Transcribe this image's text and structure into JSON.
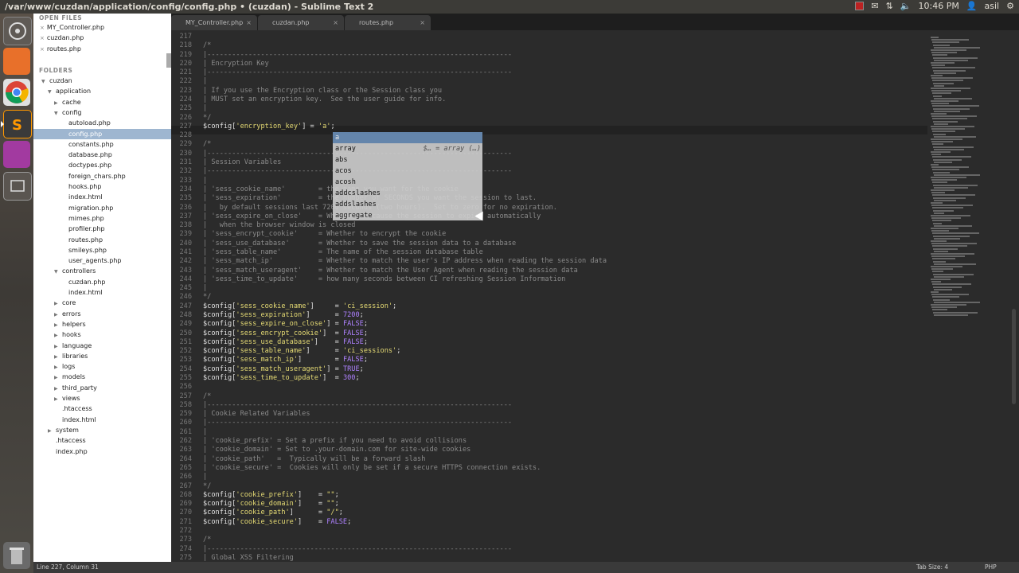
{
  "window": {
    "title": "/var/www/cuzdan/application/config/config.php • (cuzdan) - Sublime Text 2",
    "clock": "10:46 PM",
    "user": "asil"
  },
  "launcher": {
    "items": [
      {
        "name": "dash-icon",
        "color": "#5a5550"
      },
      {
        "name": "files-icon",
        "color": "#e8702a"
      },
      {
        "name": "chrome-icon",
        "color": "#2f8f3f"
      },
      {
        "name": "sublime-icon",
        "color": "#4a4a4a"
      },
      {
        "name": "video-editor-icon",
        "color": "#a23aa0"
      },
      {
        "name": "workspace-icon",
        "color": "#5a5a5a"
      },
      {
        "name": "trash-icon",
        "color": "#777"
      }
    ]
  },
  "sidebar": {
    "open_files_header": "OPEN FILES",
    "folders_header": "FOLDERS",
    "open_files": [
      "MY_Controller.php",
      "cuzdan.php",
      "routes.php"
    ],
    "tree": [
      {
        "label": "cuzdan",
        "indent": 0,
        "type": "open"
      },
      {
        "label": "application",
        "indent": 1,
        "type": "open"
      },
      {
        "label": "cache",
        "indent": 2,
        "type": "closed"
      },
      {
        "label": "config",
        "indent": 2,
        "type": "open"
      },
      {
        "label": "autoload.php",
        "indent": 3,
        "type": "file"
      },
      {
        "label": "config.php",
        "indent": 3,
        "type": "file",
        "selected": true
      },
      {
        "label": "constants.php",
        "indent": 3,
        "type": "file"
      },
      {
        "label": "database.php",
        "indent": 3,
        "type": "file"
      },
      {
        "label": "doctypes.php",
        "indent": 3,
        "type": "file"
      },
      {
        "label": "foreign_chars.php",
        "indent": 3,
        "type": "file"
      },
      {
        "label": "hooks.php",
        "indent": 3,
        "type": "file"
      },
      {
        "label": "index.html",
        "indent": 3,
        "type": "file"
      },
      {
        "label": "migration.php",
        "indent": 3,
        "type": "file"
      },
      {
        "label": "mimes.php",
        "indent": 3,
        "type": "file"
      },
      {
        "label": "profiler.php",
        "indent": 3,
        "type": "file"
      },
      {
        "label": "routes.php",
        "indent": 3,
        "type": "file"
      },
      {
        "label": "smileys.php",
        "indent": 3,
        "type": "file"
      },
      {
        "label": "user_agents.php",
        "indent": 3,
        "type": "file"
      },
      {
        "label": "controllers",
        "indent": 2,
        "type": "open"
      },
      {
        "label": "cuzdan.php",
        "indent": 3,
        "type": "file"
      },
      {
        "label": "index.html",
        "indent": 3,
        "type": "file"
      },
      {
        "label": "core",
        "indent": 2,
        "type": "closed"
      },
      {
        "label": "errors",
        "indent": 2,
        "type": "closed"
      },
      {
        "label": "helpers",
        "indent": 2,
        "type": "closed"
      },
      {
        "label": "hooks",
        "indent": 2,
        "type": "closed"
      },
      {
        "label": "language",
        "indent": 2,
        "type": "closed"
      },
      {
        "label": "libraries",
        "indent": 2,
        "type": "closed"
      },
      {
        "label": "logs",
        "indent": 2,
        "type": "closed"
      },
      {
        "label": "models",
        "indent": 2,
        "type": "closed"
      },
      {
        "label": "third_party",
        "indent": 2,
        "type": "closed"
      },
      {
        "label": "views",
        "indent": 2,
        "type": "closed"
      },
      {
        "label": ".htaccess",
        "indent": 2,
        "type": "file"
      },
      {
        "label": "index.html",
        "indent": 2,
        "type": "file"
      },
      {
        "label": "system",
        "indent": 1,
        "type": "closed"
      },
      {
        "label": ".htaccess",
        "indent": 1,
        "type": "file"
      },
      {
        "label": "index.php",
        "indent": 1,
        "type": "file"
      }
    ]
  },
  "tabs": [
    {
      "label": "MY_Controller.php",
      "close": "×"
    },
    {
      "label": "cuzdan.php",
      "close": "×"
    },
    {
      "label": "routes.php",
      "close": "×"
    }
  ],
  "editor": {
    "lines": [
      {
        "n": "217",
        "t": ""
      },
      {
        "n": "218",
        "t": "/*",
        "c": "cm"
      },
      {
        "n": "219",
        "t": "|--------------------------------------------------------------------------",
        "c": "cm"
      },
      {
        "n": "220",
        "t": "| Encryption Key",
        "c": "cm"
      },
      {
        "n": "221",
        "t": "|--------------------------------------------------------------------------",
        "c": "cm"
      },
      {
        "n": "222",
        "t": "|",
        "c": "cm"
      },
      {
        "n": "223",
        "t": "| If you use the Encryption class or the Session class you",
        "c": "cm"
      },
      {
        "n": "224",
        "t": "| MUST set an encryption key.  See the user guide for info.",
        "c": "cm"
      },
      {
        "n": "225",
        "t": "|",
        "c": "cm"
      },
      {
        "n": "226",
        "t": "*/",
        "c": "cm"
      },
      {
        "n": "227",
        "t": "$config['encryption_key'] = 'a';",
        "c": "var"
      },
      {
        "n": "228",
        "t": ""
      },
      {
        "n": "229",
        "t": "/*",
        "c": "cm"
      },
      {
        "n": "230",
        "t": "|--------------------------------------------------------------------------",
        "c": "cm"
      },
      {
        "n": "231",
        "t": "| Session Variables",
        "c": "cm"
      },
      {
        "n": "232",
        "t": "|--------------------------------------------------------------------------",
        "c": "cm"
      },
      {
        "n": "233",
        "t": "|",
        "c": "cm"
      },
      {
        "n": "234",
        "t": "| 'sess_cookie_name'        = the name you want for the cookie",
        "c": "cm"
      },
      {
        "n": "235",
        "t": "| 'sess_expiration'         = the number of SECONDS you want the session to last.",
        "c": "cm"
      },
      {
        "n": "236",
        "t": "|   by default sessions last 7200 seconds (two hours).  Set to zero for no expiration.",
        "c": "cm"
      },
      {
        "n": "237",
        "t": "| 'sess_expire_on_close'    = Whether to cause the session to expire automatically",
        "c": "cm"
      },
      {
        "n": "238",
        "t": "|   when the browser window is closed",
        "c": "cm"
      },
      {
        "n": "239",
        "t": "| 'sess_encrypt_cookie'     = Whether to encrypt the cookie",
        "c": "cm"
      },
      {
        "n": "240",
        "t": "| 'sess_use_database'       = Whether to save the session data to a database",
        "c": "cm"
      },
      {
        "n": "241",
        "t": "| 'sess_table_name'         = The name of the session database table",
        "c": "cm"
      },
      {
        "n": "242",
        "t": "| 'sess_match_ip'           = Whether to match the user's IP address when reading the session data",
        "c": "cm"
      },
      {
        "n": "243",
        "t": "| 'sess_match_useragent'    = Whether to match the User Agent when reading the session data",
        "c": "cm"
      },
      {
        "n": "244",
        "t": "| 'sess_time_to_update'     = how many seconds between CI refreshing Session Information",
        "c": "cm"
      },
      {
        "n": "245",
        "t": "|",
        "c": "cm"
      },
      {
        "n": "246",
        "t": "*/",
        "c": "cm"
      },
      {
        "n": "247",
        "t": "$config['sess_cookie_name']     = 'ci_session';",
        "c": "var"
      },
      {
        "n": "248",
        "t": "$config['sess_expiration']      = 7200;",
        "c": "var"
      },
      {
        "n": "249",
        "t": "$config['sess_expire_on_close'] = FALSE;",
        "c": "var"
      },
      {
        "n": "250",
        "t": "$config['sess_encrypt_cookie']  = FALSE;",
        "c": "var"
      },
      {
        "n": "251",
        "t": "$config['sess_use_database']    = FALSE;",
        "c": "var"
      },
      {
        "n": "252",
        "t": "$config['sess_table_name']      = 'ci_sessions';",
        "c": "var"
      },
      {
        "n": "253",
        "t": "$config['sess_match_ip']        = FALSE;",
        "c": "var"
      },
      {
        "n": "254",
        "t": "$config['sess_match_useragent'] = TRUE;",
        "c": "var"
      },
      {
        "n": "255",
        "t": "$config['sess_time_to_update']  = 300;",
        "c": "var"
      },
      {
        "n": "256",
        "t": ""
      },
      {
        "n": "257",
        "t": "/*",
        "c": "cm"
      },
      {
        "n": "258",
        "t": "|--------------------------------------------------------------------------",
        "c": "cm"
      },
      {
        "n": "259",
        "t": "| Cookie Related Variables",
        "c": "cm"
      },
      {
        "n": "260",
        "t": "|--------------------------------------------------------------------------",
        "c": "cm"
      },
      {
        "n": "261",
        "t": "|",
        "c": "cm"
      },
      {
        "n": "262",
        "t": "| 'cookie_prefix' = Set a prefix if you need to avoid collisions",
        "c": "cm"
      },
      {
        "n": "263",
        "t": "| 'cookie_domain' = Set to .your-domain.com for site-wide cookies",
        "c": "cm"
      },
      {
        "n": "264",
        "t": "| 'cookie_path'   =  Typically will be a forward slash",
        "c": "cm"
      },
      {
        "n": "265",
        "t": "| 'cookie_secure' =  Cookies will only be set if a secure HTTPS connection exists.",
        "c": "cm"
      },
      {
        "n": "266",
        "t": "|",
        "c": "cm"
      },
      {
        "n": "267",
        "t": "*/",
        "c": "cm"
      },
      {
        "n": "268",
        "t": "$config['cookie_prefix']    = \"\";",
        "c": "var"
      },
      {
        "n": "269",
        "t": "$config['cookie_domain']    = \"\";",
        "c": "var"
      },
      {
        "n": "270",
        "t": "$config['cookie_path']      = \"/\";",
        "c": "var"
      },
      {
        "n": "271",
        "t": "$config['cookie_secure']    = FALSE;",
        "c": "var"
      },
      {
        "n": "272",
        "t": ""
      },
      {
        "n": "273",
        "t": "/*",
        "c": "cm"
      },
      {
        "n": "274",
        "t": "|--------------------------------------------------------------------------",
        "c": "cm"
      },
      {
        "n": "275",
        "t": "| Global XSS Filtering",
        "c": "cm"
      }
    ]
  },
  "autocomplete": {
    "items": [
      {
        "label": "a",
        "hint": "",
        "selected": true
      },
      {
        "label": "array",
        "hint": "$… = array (…)"
      },
      {
        "label": "abs",
        "hint": ""
      },
      {
        "label": "acos",
        "hint": ""
      },
      {
        "label": "acosh",
        "hint": ""
      },
      {
        "label": "addcslashes",
        "hint": ""
      },
      {
        "label": "addslashes",
        "hint": ""
      },
      {
        "label": "aggregate",
        "hint": ""
      }
    ]
  },
  "status": {
    "position": "Line 227, Column 31",
    "tab_size": "Tab Size: 4",
    "syntax": "PHP"
  }
}
